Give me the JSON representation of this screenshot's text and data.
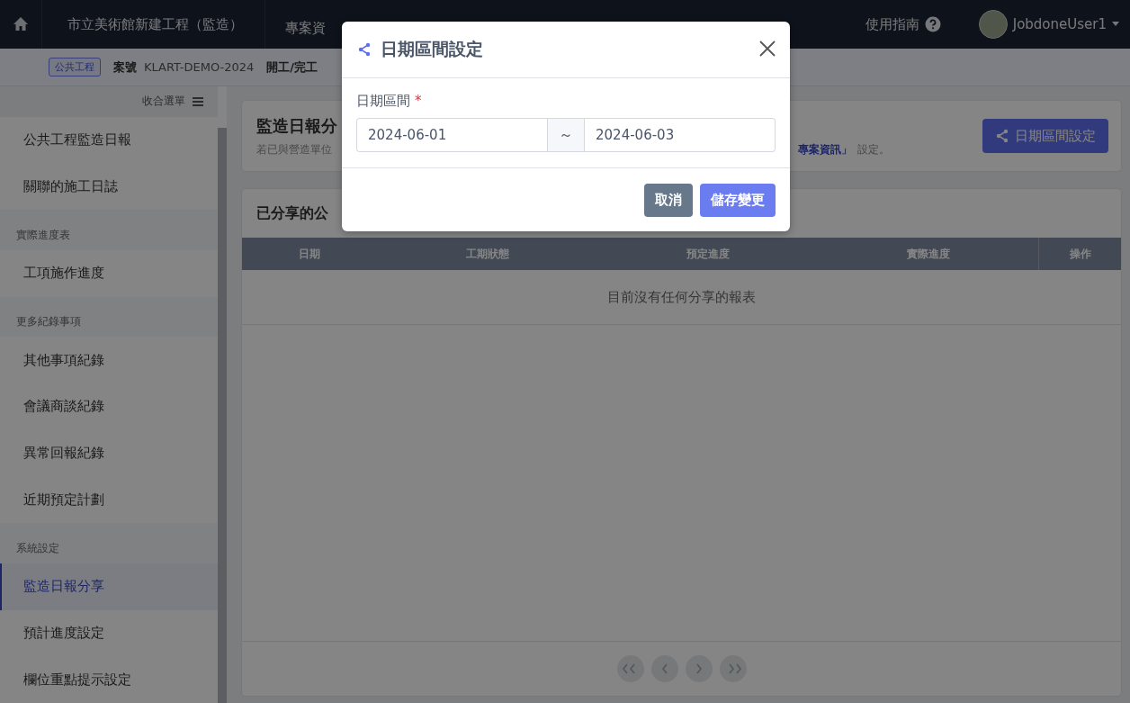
{
  "top_bar": {
    "project_title": "市立美術館新建工程（監造）",
    "nav_items": [
      {
        "label": "專案資",
        "selected": false
      }
    ],
    "guide": "使用指南",
    "user": "JobdoneUser1"
  },
  "breadcrumb": {
    "badge": "公共工程",
    "case_label": "案號",
    "case_no": "KLART-DEMO-2024",
    "crumb": "開工/完工"
  },
  "sidebar": {
    "collapse": "收合選單",
    "items": [
      {
        "kind": "item",
        "label": "公共工程監造日報",
        "selected": false
      },
      {
        "kind": "item",
        "label": "關聯的施工日誌",
        "selected": false
      },
      {
        "kind": "section",
        "label": "實際進度表"
      },
      {
        "kind": "item",
        "label": "工項施作進度",
        "selected": false
      },
      {
        "kind": "section",
        "label": "更多紀錄事項"
      },
      {
        "kind": "item",
        "label": "其他事項紀錄",
        "selected": false
      },
      {
        "kind": "item",
        "label": "會議商談紀錄",
        "selected": false
      },
      {
        "kind": "item",
        "label": "異常回報紀錄",
        "selected": false
      },
      {
        "kind": "item",
        "label": "近期預定計劃",
        "selected": false
      },
      {
        "kind": "section",
        "label": "系統設定"
      },
      {
        "kind": "item",
        "label": "監造日報分享",
        "selected": true
      },
      {
        "kind": "item",
        "label": "預計進度設定",
        "selected": false
      },
      {
        "kind": "item",
        "label": "欄位重點提示設定",
        "selected": false
      }
    ]
  },
  "page_header": {
    "title": "監造日報分",
    "subtitle_start": "若已與營造單位",
    "subtitle_link": "專案資訊」",
    "subtitle_end": "設定。",
    "button": "日期區間設定"
  },
  "shared_card": {
    "title": "已分享的公",
    "columns": [
      "日期",
      "工期狀態",
      "預定進度",
      "實際進度",
      "操作"
    ],
    "empty": "目前沒有任何分享的報表"
  },
  "modal": {
    "title": "日期區間設定",
    "field_label": "日期區間",
    "required_mark": "*",
    "start_date": "2024-06-01",
    "separator": "～",
    "end_date": "2024-06-03",
    "cancel": "取消",
    "save": "儲存變更"
  }
}
